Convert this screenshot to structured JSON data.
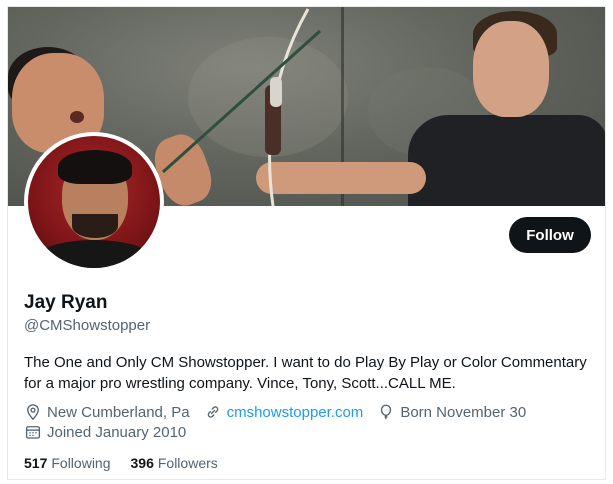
{
  "profile": {
    "display_name": "Jay Ryan",
    "handle": "@CMShowstopper",
    "follow_label": "Follow",
    "bio": "The One and Only CM Showstopper. I want to do Play By Play or Color Commentary for a major pro wrestling company. Vince, Tony, Scott...CALL ME.",
    "location": "New Cumberland, Pa",
    "website": "cmshowstopper.com",
    "birthday": "Born November 30",
    "joined": "Joined January 2010",
    "following_count": "517",
    "following_label": "Following",
    "followers_count": "396",
    "followers_label": "Followers"
  },
  "icons": {
    "location": "location-pin-icon",
    "website": "link-icon",
    "birthday": "balloon-icon",
    "joined": "calendar-icon"
  },
  "colors": {
    "link": "#1d9bf0",
    "button_bg": "#0f1419",
    "secondary_text": "#536471"
  }
}
